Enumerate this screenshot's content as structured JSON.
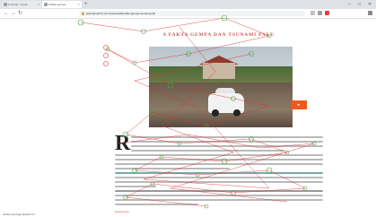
{
  "browser": {
    "tabs": [
      {
        "label": "G Gmail - Kotak..."
      },
      {
        "label": "8 fakta gempa..."
      }
    ],
    "new_tab": "+",
    "url": "www.liputan6.com/news/read/8-fakta-gempa-tsunami-palu",
    "window_controls": [
      "–",
      "□",
      "✕"
    ]
  },
  "article": {
    "title": "8 FAKTA GEMPA DAN TSUNAMI PALU",
    "dropcap": "R",
    "button_label": "▸",
    "see_more": "Selanjutnya"
  },
  "status_bar": {
    "text": "Sedang menunggu liputan6.com..."
  },
  "colors": {
    "gaze_line": "#e03030",
    "fixation": "#3fae3f",
    "accent": "#f0591a",
    "title": "#d05050"
  }
}
